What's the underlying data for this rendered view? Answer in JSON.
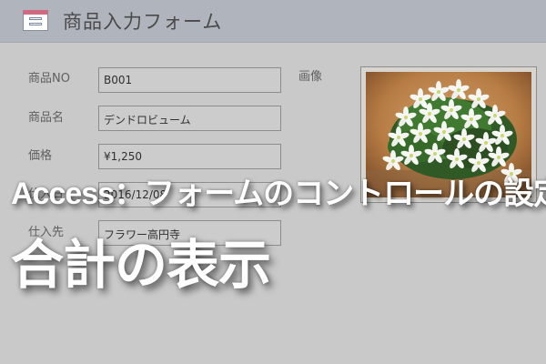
{
  "header": {
    "icon": "form-icon",
    "title": "商品入力フォーム"
  },
  "form": {
    "fields": [
      {
        "label": "商品NO",
        "value": "B001"
      },
      {
        "label": "商品名",
        "value": "デンドロビューム"
      },
      {
        "label": "価格",
        "value": "¥1,250"
      },
      {
        "label": "仕入日",
        "value": "2016/12/08"
      },
      {
        "label": "仕入先",
        "value": "フラワー高円寺"
      }
    ],
    "image_label": "画像"
  },
  "overlay": {
    "line1": "Access：フォームのコントロールの設定",
    "line2": "合計の表示"
  },
  "colors": {
    "background": "#c9c9c9",
    "header": "#b0b5bd",
    "overlay_text": "#ffffff"
  }
}
